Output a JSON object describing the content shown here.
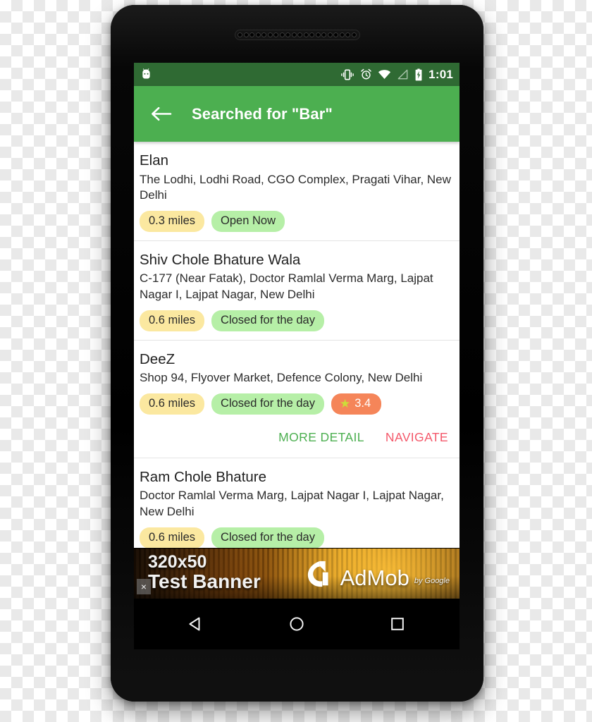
{
  "status_bar": {
    "time": "1:01",
    "icons": [
      "android-head-icon",
      "vibrate-icon",
      "alarm-icon",
      "wifi-icon",
      "cell-signal-icon",
      "battery-charging-icon"
    ],
    "background_color": "#2F6A33"
  },
  "app_bar": {
    "back_label": "back-arrow",
    "title": "Searched for \"Bar\"",
    "background_color": "#4CAF50"
  },
  "results": [
    {
      "name": "Elan",
      "address": "The Lodhi, Lodhi Road, CGO Complex, Pragati Vihar, New Delhi",
      "distance": "0.3 miles",
      "status": "Open Now",
      "rating": null,
      "actions": null
    },
    {
      "name": "Shiv Chole Bhature Wala",
      "address": "C-177 (Near Fatak), Doctor Ramlal Verma Marg, Lajpat Nagar I, Lajpat Nagar, New Delhi",
      "distance": "0.6 miles",
      "status": "Closed for the day",
      "rating": null,
      "actions": null
    },
    {
      "name": "DeeZ",
      "address": "Shop 94, Flyover Market, Defence Colony, New Delhi",
      "distance": "0.6 miles",
      "status": "Closed for the day",
      "rating": "3.4",
      "actions": {
        "more_detail": "MORE DETAIL",
        "navigate": "NAVIGATE"
      }
    },
    {
      "name": "Ram Chole Bhature",
      "address": "Doctor Ramlal Verma Marg, Lajpat Nagar I, Lajpat Nagar, New Delhi",
      "distance": "0.6 miles",
      "status": "Closed for the day",
      "rating": null,
      "actions": null
    }
  ],
  "ad_banner": {
    "line1": "320x50",
    "line2": "Test Banner",
    "close_label": "×",
    "brand": "AdMob",
    "brand_suffix": "by Google"
  },
  "nav_bar": {
    "back": "back-triangle",
    "home": "home-circle",
    "recents": "recents-square"
  },
  "colors": {
    "accent_green": "#4CAF50",
    "status_bar_green": "#2F6A33",
    "chip_distance": "#FBE8A0",
    "chip_status": "#B6EFA7",
    "chip_rating": "#F58559",
    "star": "#CDDC39",
    "navigate_red": "#F4586A"
  }
}
